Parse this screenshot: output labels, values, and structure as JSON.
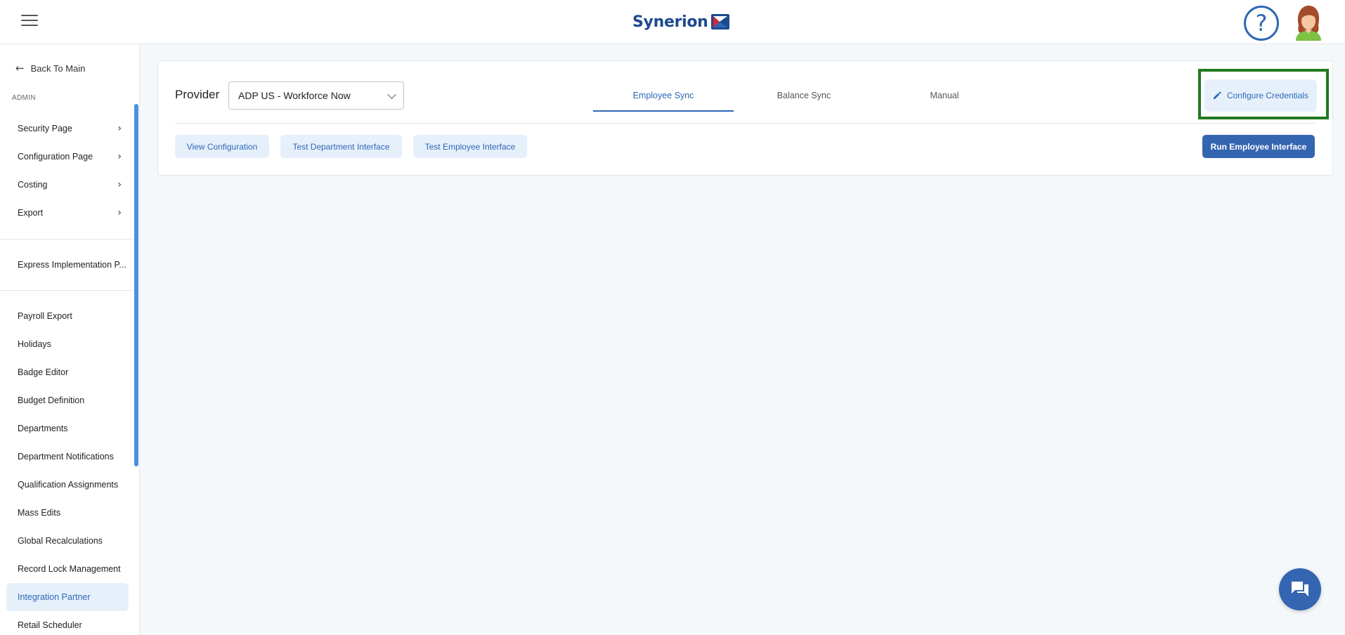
{
  "header": {
    "logo_text": "Synerion",
    "help_glyph": "?",
    "icons": {
      "menu": "hamburger-icon",
      "help": "help-icon",
      "avatar": "user-avatar"
    },
    "colors": {
      "brand": "#1d4a8f",
      "accent": "#2f68b4",
      "brand_red": "#d8282f"
    }
  },
  "sidebar": {
    "back_label": "Back To Main",
    "section_label": "ADMIN",
    "expandable_items": [
      {
        "label": "Security Page"
      },
      {
        "label": "Configuration Page"
      },
      {
        "label": "Costing"
      },
      {
        "label": "Export"
      }
    ],
    "express_item": {
      "label": "Express Implementation P..."
    },
    "items": [
      {
        "label": "Payroll Export"
      },
      {
        "label": "Holidays"
      },
      {
        "label": "Badge Editor"
      },
      {
        "label": "Budget Definition"
      },
      {
        "label": "Departments"
      },
      {
        "label": "Department Notifications"
      },
      {
        "label": "Qualification Assignments"
      },
      {
        "label": "Mass Edits"
      },
      {
        "label": "Global Recalculations"
      },
      {
        "label": "Record Lock Management"
      },
      {
        "label": "Integration Partner"
      },
      {
        "label": "Retail Scheduler"
      }
    ],
    "active_item": "Integration Partner"
  },
  "main": {
    "provider_label": "Provider",
    "provider_value": "ADP US - Workforce Now",
    "tabs": [
      {
        "label": "Employee Sync"
      },
      {
        "label": "Balance Sync"
      },
      {
        "label": "Manual"
      }
    ],
    "active_tab": "Employee Sync",
    "configure_label": "Configure Credentials",
    "actions": {
      "view_configuration": "View Configuration",
      "test_department": "Test Department Interface",
      "test_employee": "Test Employee Interface",
      "run_employee": "Run Employee Interface"
    },
    "highlight_color": "#1f7a1f"
  }
}
